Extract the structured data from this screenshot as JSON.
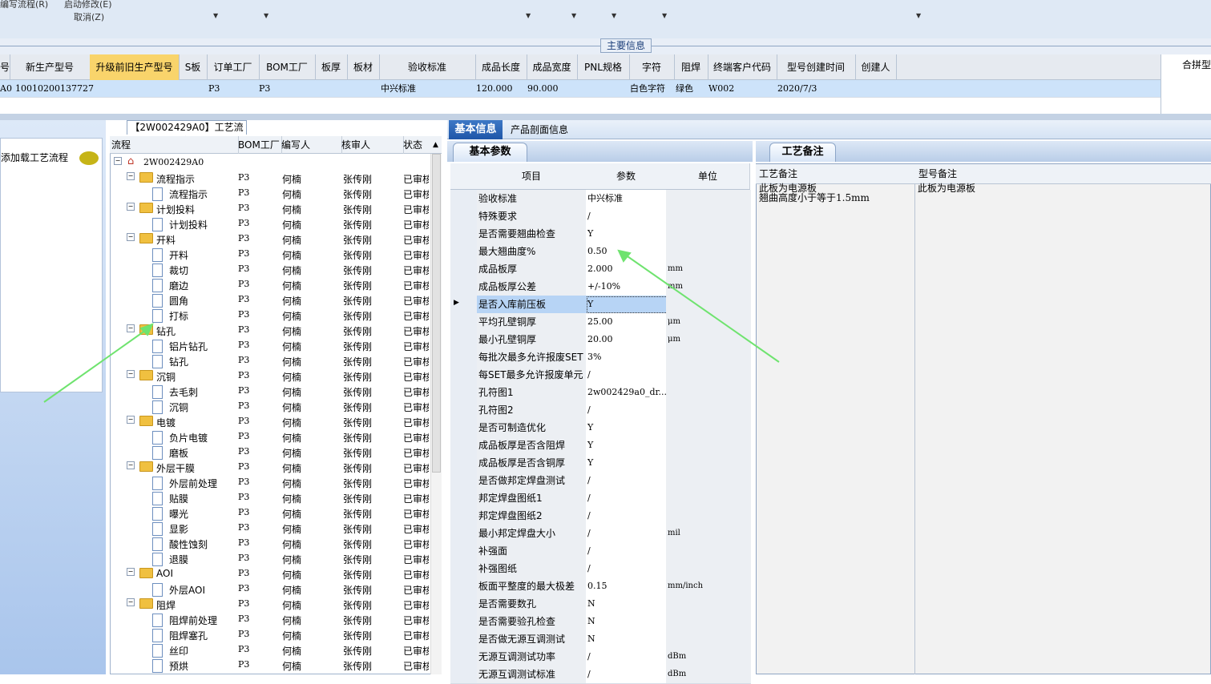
{
  "menu": {
    "item1": "编写流程(R)",
    "item2": "启动修改(E)",
    "item3": "取消(Z)"
  },
  "main_info_label": "主要信息",
  "main_table": {
    "columns": [
      "号",
      "新生产型号",
      "升级前旧生产型号",
      "S板",
      "订单工厂",
      "BOM工厂",
      "板厚",
      "板材",
      "验收标准",
      "成品长度",
      "成品宽度",
      "PNL规格",
      "字符",
      "阻焊",
      "终端客户代码",
      "型号创建时间",
      "创建人"
    ],
    "right_column": "合拼型",
    "row": {
      "c0": "A0",
      "new_model": "10010200137727",
      "order_factory": "P3",
      "bom_factory": "P3",
      "standard": "中兴标准",
      "length": "120.000",
      "width": "90.000",
      "char": "白色字符",
      "mask": "绿色",
      "customer": "W002",
      "created": "2020/7/3"
    }
  },
  "left_panel": {
    "button": "添加载工艺流程"
  },
  "process": {
    "title": "【2W002429A0】工艺流程",
    "columns": [
      "流程",
      "BOM工厂",
      "编写人",
      "核审人",
      "状态"
    ],
    "root": "2W002429A0",
    "rows": [
      {
        "name": "流程指示",
        "level": 1,
        "bom": "P3",
        "writer": "何楠",
        "reviewer": "张传刚",
        "status": "已审核"
      },
      {
        "name": "流程指示",
        "level": 2,
        "bom": "P3",
        "writer": "何楠",
        "reviewer": "张传刚",
        "status": "已审核"
      },
      {
        "name": "计划投料",
        "level": 1,
        "bom": "P3",
        "writer": "何楠",
        "reviewer": "张传刚",
        "status": "已审核"
      },
      {
        "name": "计划投料",
        "level": 2,
        "bom": "P3",
        "writer": "何楠",
        "reviewer": "张传刚",
        "status": "已审核"
      },
      {
        "name": "开料",
        "level": 1,
        "bom": "P3",
        "writer": "何楠",
        "reviewer": "张传刚",
        "status": "已审核"
      },
      {
        "name": "开料",
        "level": 2,
        "bom": "P3",
        "writer": "何楠",
        "reviewer": "张传刚",
        "status": "已审核"
      },
      {
        "name": "裁切",
        "level": 2,
        "bom": "P3",
        "writer": "何楠",
        "reviewer": "张传刚",
        "status": "已审核"
      },
      {
        "name": "磨边",
        "level": 2,
        "bom": "P3",
        "writer": "何楠",
        "reviewer": "张传刚",
        "status": "已审核"
      },
      {
        "name": "圆角",
        "level": 2,
        "bom": "P3",
        "writer": "何楠",
        "reviewer": "张传刚",
        "status": "已审核"
      },
      {
        "name": "打标",
        "level": 2,
        "bom": "P3",
        "writer": "何楠",
        "reviewer": "张传刚",
        "status": "已审核"
      },
      {
        "name": "钻孔",
        "level": 1,
        "bom": "P3",
        "writer": "何楠",
        "reviewer": "张传刚",
        "status": "已审核"
      },
      {
        "name": "铝片钻孔",
        "level": 2,
        "bom": "P3",
        "writer": "何楠",
        "reviewer": "张传刚",
        "status": "已审核"
      },
      {
        "name": "钻孔",
        "level": 2,
        "bom": "P3",
        "writer": "何楠",
        "reviewer": "张传刚",
        "status": "已审核"
      },
      {
        "name": "沉铜",
        "level": 1,
        "bom": "P3",
        "writer": "何楠",
        "reviewer": "张传刚",
        "status": "已审核"
      },
      {
        "name": "去毛刺",
        "level": 2,
        "bom": "P3",
        "writer": "何楠",
        "reviewer": "张传刚",
        "status": "已审核"
      },
      {
        "name": "沉铜",
        "level": 2,
        "bom": "P3",
        "writer": "何楠",
        "reviewer": "张传刚",
        "status": "已审核"
      },
      {
        "name": "电镀",
        "level": 1,
        "bom": "P3",
        "writer": "何楠",
        "reviewer": "张传刚",
        "status": "已审核"
      },
      {
        "name": "负片电镀",
        "level": 2,
        "bom": "P3",
        "writer": "何楠",
        "reviewer": "张传刚",
        "status": "已审核"
      },
      {
        "name": "磨板",
        "level": 2,
        "bom": "P3",
        "writer": "何楠",
        "reviewer": "张传刚",
        "status": "已审核"
      },
      {
        "name": "外层干膜",
        "level": 1,
        "bom": "P3",
        "writer": "何楠",
        "reviewer": "张传刚",
        "status": "已审核"
      },
      {
        "name": "外层前处理",
        "level": 2,
        "bom": "P3",
        "writer": "何楠",
        "reviewer": "张传刚",
        "status": "已审核"
      },
      {
        "name": "贴膜",
        "level": 2,
        "bom": "P3",
        "writer": "何楠",
        "reviewer": "张传刚",
        "status": "已审核"
      },
      {
        "name": "曝光",
        "level": 2,
        "bom": "P3",
        "writer": "何楠",
        "reviewer": "张传刚",
        "status": "已审核"
      },
      {
        "name": "显影",
        "level": 2,
        "bom": "P3",
        "writer": "何楠",
        "reviewer": "张传刚",
        "status": "已审核"
      },
      {
        "name": "酸性蚀刻",
        "level": 2,
        "bom": "P3",
        "writer": "何楠",
        "reviewer": "张传刚",
        "status": "已审核"
      },
      {
        "name": "退膜",
        "level": 2,
        "bom": "P3",
        "writer": "何楠",
        "reviewer": "张传刚",
        "status": "已审核"
      },
      {
        "name": "AOI",
        "level": 1,
        "bom": "P3",
        "writer": "何楠",
        "reviewer": "张传刚",
        "status": "已审核"
      },
      {
        "name": "外层AOI",
        "level": 2,
        "bom": "P3",
        "writer": "何楠",
        "reviewer": "张传刚",
        "status": "已审核"
      },
      {
        "name": "阻焊",
        "level": 1,
        "bom": "P3",
        "writer": "何楠",
        "reviewer": "张传刚",
        "status": "已审核"
      },
      {
        "name": "阻焊前处理",
        "level": 2,
        "bom": "P3",
        "writer": "何楠",
        "reviewer": "张传刚",
        "status": "已审核"
      },
      {
        "name": "阻焊塞孔",
        "level": 2,
        "bom": "P3",
        "writer": "何楠",
        "reviewer": "张传刚",
        "status": "已审核"
      },
      {
        "name": "丝印",
        "level": 2,
        "bom": "P3",
        "writer": "何楠",
        "reviewer": "张传刚",
        "status": "已审核"
      },
      {
        "name": "预烘",
        "level": 2,
        "bom": "P3",
        "writer": "何楠",
        "reviewer": "张传刚",
        "status": "已审核"
      }
    ]
  },
  "tabs": {
    "basic": "基本信息",
    "profile": "产品剖面信息"
  },
  "basic_params": {
    "title": "基本参数",
    "columns": [
      "项目",
      "参数",
      "单位"
    ],
    "selected_index": 6,
    "rows": [
      {
        "item": "验收标准",
        "value": "中兴标准",
        "unit": ""
      },
      {
        "item": "特殊要求",
        "value": "/",
        "unit": ""
      },
      {
        "item": "是否需要翘曲检查",
        "value": "Y",
        "unit": ""
      },
      {
        "item": "最大翘曲度%",
        "value": "0.50",
        "unit": ""
      },
      {
        "item": "成品板厚",
        "value": "2.000",
        "unit": "mm"
      },
      {
        "item": "成品板厚公差",
        "value": "+/-10%",
        "unit": "mm"
      },
      {
        "item": "是否入库前压板",
        "value": "Y",
        "unit": ""
      },
      {
        "item": "平均孔壁铜厚",
        "value": "25.00",
        "unit": "μm"
      },
      {
        "item": "最小孔壁铜厚",
        "value": "20.00",
        "unit": "μm"
      },
      {
        "item": "每批次最多允许报废SET",
        "value": "3%",
        "unit": ""
      },
      {
        "item": "每SET最多允许报废单元",
        "value": "/",
        "unit": ""
      },
      {
        "item": "孔符图1",
        "value": "2w002429a0_dr...",
        "unit": ""
      },
      {
        "item": "孔符图2",
        "value": "/",
        "unit": ""
      },
      {
        "item": "是否可制造优化",
        "value": "Y",
        "unit": ""
      },
      {
        "item": "成品板厚是否含阻焊",
        "value": "Y",
        "unit": ""
      },
      {
        "item": "成品板厚是否含铜厚",
        "value": "Y",
        "unit": ""
      },
      {
        "item": "是否做邦定焊盘测试",
        "value": "/",
        "unit": ""
      },
      {
        "item": "邦定焊盘图纸1",
        "value": "/",
        "unit": ""
      },
      {
        "item": "邦定焊盘图纸2",
        "value": "/",
        "unit": ""
      },
      {
        "item": "最小邦定焊盘大小",
        "value": "/",
        "unit": "mil"
      },
      {
        "item": "补强面",
        "value": "/",
        "unit": ""
      },
      {
        "item": "补强图纸",
        "value": "/",
        "unit": ""
      },
      {
        "item": "板面平整度的最大极差",
        "value": "0.15",
        "unit": "mm/inch"
      },
      {
        "item": "是否需要数孔",
        "value": "N",
        "unit": ""
      },
      {
        "item": "是否需要验孔检查",
        "value": "N",
        "unit": ""
      },
      {
        "item": "是否做无源互调测试",
        "value": "N",
        "unit": ""
      },
      {
        "item": "无源互调测试功率",
        "value": "/",
        "unit": "dBm"
      },
      {
        "item": "无源互调测试标准",
        "value": "/",
        "unit": "dBm"
      }
    ]
  },
  "remarks": {
    "title": "工艺备注",
    "col1": "工艺备注",
    "col2": "型号备注",
    "process_note_line1": "此板为电源板",
    "process_note_line2": "翘曲高度小于等于1.5mm",
    "model_note": "此板为电源板"
  }
}
